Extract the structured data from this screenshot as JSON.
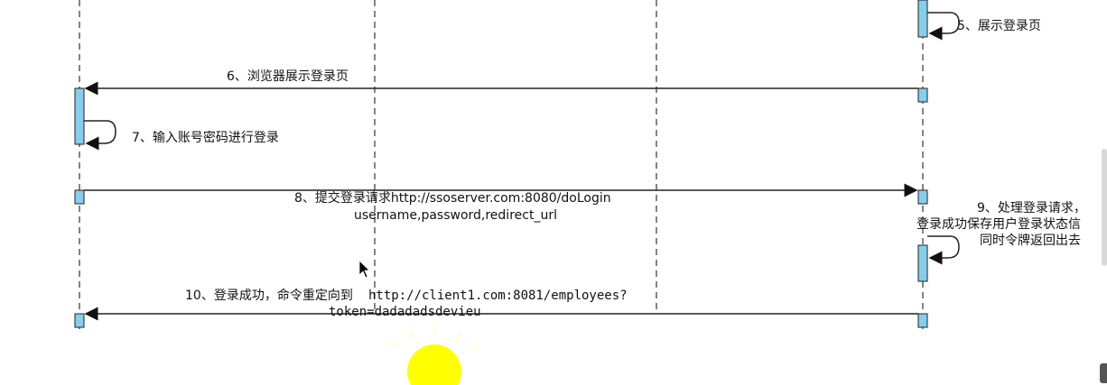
{
  "diagram": {
    "messages": {
      "m5": "5、展示登录页",
      "m6": "6、浏览器展示登录页",
      "m7": "7、输入账号密码进行登录",
      "m8_line1": "8、提交登录请求http://ssoserver.com:8080/doLogin",
      "m8_line2": "username,password,redirect_url",
      "m9_line1": "9、处理登录请求，",
      "m9_line2": "登录成功保存用户登录状态信",
      "m9_line3": "同时令牌返回出去",
      "m10_line1a": "10、登录成功，命令重定向到",
      "m10_line1b": "http://client1.com:8081/employees?",
      "m10_line2": "token=dadadadsdevieu"
    }
  },
  "colors": {
    "activation_fill": "#87ceeb",
    "line": "#222222",
    "cursor_highlight": "#ffff00"
  }
}
